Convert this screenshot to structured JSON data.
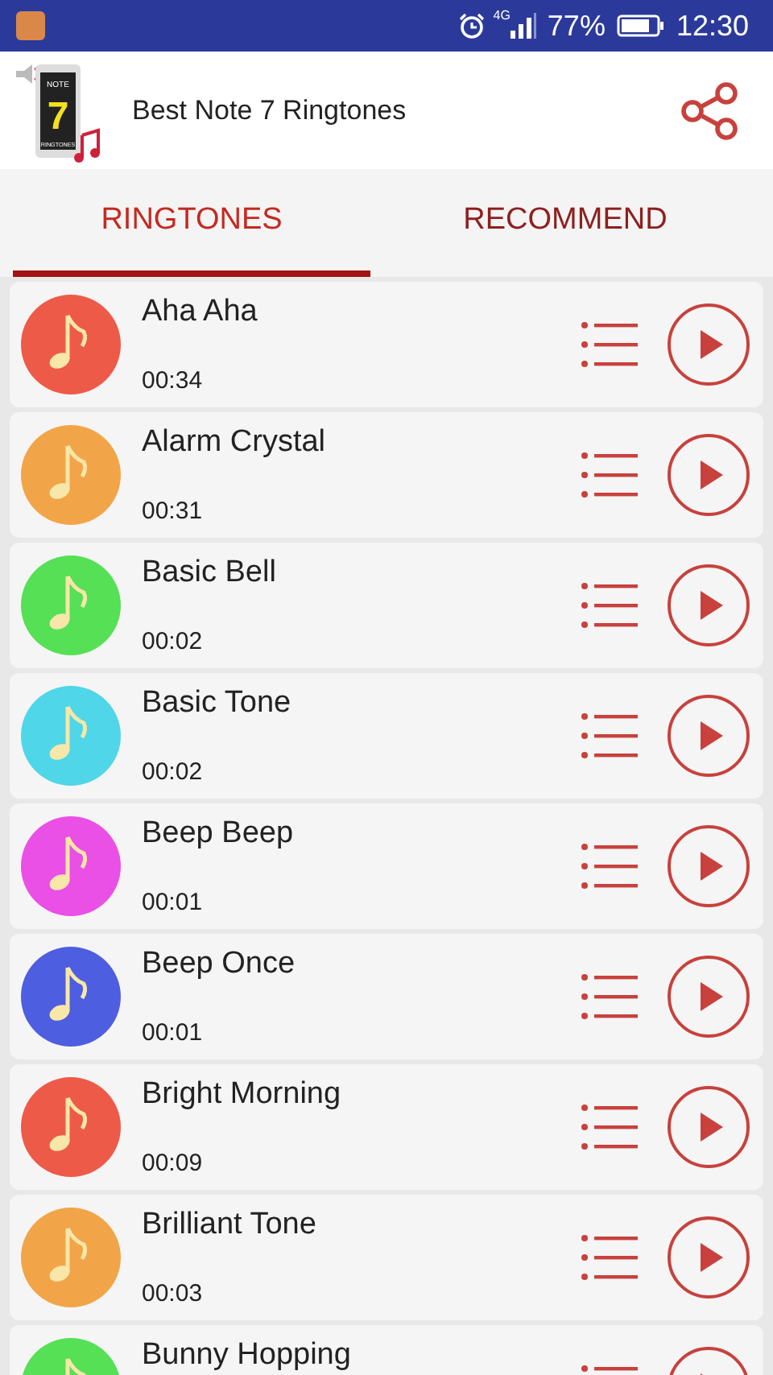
{
  "status_bar": {
    "network": "4G",
    "battery": "77%",
    "time": "12:30"
  },
  "header": {
    "logo": {
      "top": "NOTE",
      "number": "7",
      "bottom": "RINGTONES"
    },
    "title": "Best Note 7 Ringtones"
  },
  "tabs": [
    {
      "label": "RINGTONES",
      "selected": true
    },
    {
      "label": "RECOMMEND",
      "selected": false
    }
  ],
  "ringtones": [
    {
      "name": "Aha Aha",
      "duration": "00:34",
      "color": "#ee5a48"
    },
    {
      "name": "Alarm Crystal",
      "duration": "00:31",
      "color": "#f2a548"
    },
    {
      "name": "Basic Bell",
      "duration": "00:02",
      "color": "#55e055"
    },
    {
      "name": "Basic Tone",
      "duration": "00:02",
      "color": "#4fd6e8"
    },
    {
      "name": "Beep Beep",
      "duration": "00:01",
      "color": "#ea4fe6"
    },
    {
      "name": "Beep Once",
      "duration": "00:01",
      "color": "#4e5ee0"
    },
    {
      "name": "Bright Morning",
      "duration": "00:09",
      "color": "#ee5a48"
    },
    {
      "name": "Brilliant Tone",
      "duration": "00:03",
      "color": "#f2a548"
    },
    {
      "name": "Bunny Hopping",
      "color": "#55e055"
    }
  ]
}
